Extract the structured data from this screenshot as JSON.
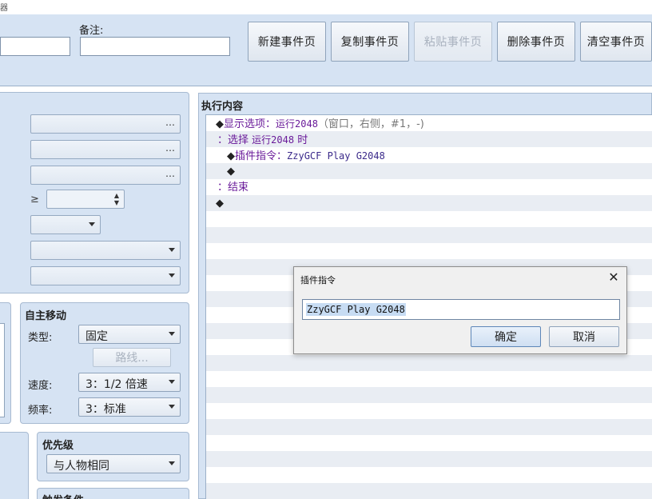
{
  "window": {
    "title_fragment": "器"
  },
  "top": {
    "note_label": "备注:",
    "name_value": "",
    "note_value": "",
    "buttons": {
      "new_page": "新建事件页",
      "copy_page": "复制事件页",
      "paste_page": "粘贴事件页",
      "delete_page": "删除事件页",
      "clear_page": "清空事件页"
    }
  },
  "conditions": {
    "dots": "…",
    "ge_symbol": "≥"
  },
  "autonomous": {
    "title": "自主移动",
    "type_label": "类型:",
    "type_value": "固定",
    "route_button": "路线...",
    "speed_label": "速度:",
    "speed_value": "3：1/2 倍速",
    "freq_label": "频率:",
    "freq_value": "3：标准"
  },
  "priority": {
    "title": "优先级",
    "value": "与人物相同"
  },
  "trigger": {
    "title": "触发条件"
  },
  "content": {
    "title": "执行内容",
    "rows": [
      {
        "diamond": "◆",
        "cmd": "显示选项：",
        "args": "运行2048",
        "extra": "（窗口，右侧，#1，-)"
      },
      {
        "prefix": "：",
        "cmd": "选择 ",
        "args": "运行2048",
        "tail": " 时"
      },
      {
        "diamond": "◆",
        "cmd": "插件指令：",
        "args": "ZzyGCF Play G2048"
      },
      {
        "diamond": "◆"
      },
      {
        "prefix": "：",
        "cmd": "结束"
      },
      {
        "diamond": "◆"
      }
    ]
  },
  "dialog": {
    "title": "插件指令",
    "close": "✕",
    "input_value": "ZzyGCF Play G2048",
    "ok": "确定",
    "cancel": "取消"
  }
}
